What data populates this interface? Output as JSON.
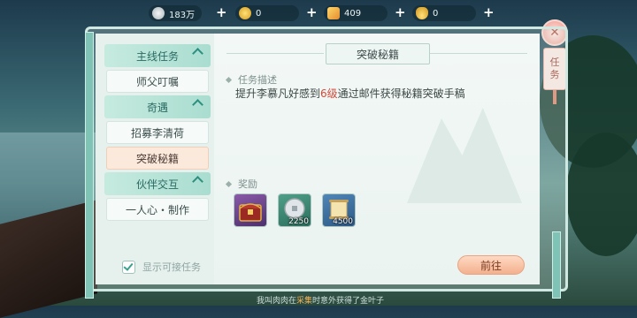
{
  "resources": [
    {
      "icon": "silver-coin-icon",
      "value": "183万"
    },
    {
      "icon": "gold-coin-icon",
      "value": "0"
    },
    {
      "icon": "gem-icon",
      "value": "409"
    },
    {
      "icon": "ingot-icon",
      "value": "0"
    }
  ],
  "task_tab": {
    "char1": "任",
    "char2": "务"
  },
  "sidebar": {
    "categories": [
      {
        "label": "主线任务"
      },
      {
        "label": "奇遇"
      },
      {
        "label": "伙伴交互"
      }
    ],
    "items": [
      {
        "label": "师父叮嘱"
      },
      {
        "label": "招募李清荷"
      },
      {
        "label": "突破秘籍"
      },
      {
        "label": "一人心・制作"
      }
    ],
    "show_available": "显示可接任务"
  },
  "detail": {
    "title": "突破秘籍",
    "desc_label": "任务描述",
    "desc_before": "提升李慕凡好感到",
    "desc_highlight": "6级",
    "desc_after": "通过邮件获得秘籍突破手稿",
    "reward_label": "奖励",
    "rewards": [
      {
        "icon": "treasure-chest-icon",
        "qty": ""
      },
      {
        "icon": "silver-coin-icon",
        "qty": "2250"
      },
      {
        "icon": "scroll-icon",
        "qty": "4500"
      }
    ],
    "go_button": "前往"
  },
  "chat": {
    "before": "我叫肉肉在",
    "highlight": "采集",
    "after": "时意外获得了金叶子"
  }
}
